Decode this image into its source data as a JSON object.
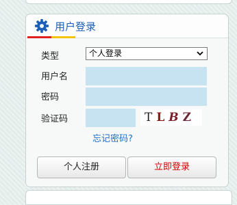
{
  "colors": {
    "accent_blue": "#1d5fb8",
    "field_bg": "#c7e2f0",
    "login_red": "#d60000",
    "link_blue": "#1d6fc8"
  },
  "header": {
    "icon": "gear-icon",
    "title": "用户登录"
  },
  "form": {
    "type_label": "类型",
    "type_value": "个人登录",
    "username_label": "用户名",
    "password_label": "密码",
    "captcha_label": "验证码",
    "captcha_chars": [
      "T",
      "L",
      "B",
      "Z"
    ],
    "captcha_colors": [
      "#222222",
      "#8b1a1a",
      "#7a1f2a",
      "#6b2a3a"
    ],
    "forgot_text": "忘记密码?"
  },
  "buttons": {
    "register": "个人注册",
    "login": "立即登录"
  }
}
